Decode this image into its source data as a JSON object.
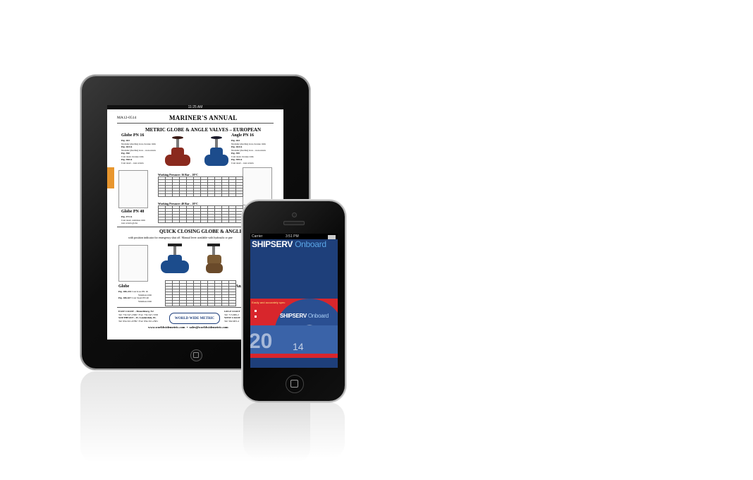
{
  "ipad": {
    "status_time": "11:25 AM",
    "doc": {
      "code": "MA12-0514",
      "title": "MARINER'S  ANNUAL",
      "section1": "METRIC GLOBE & ANGLE VALVES – EUROPEAN",
      "left_heading": "Globe PN 16",
      "right_heading": "Angle PN 16",
      "left_items": [
        "Fig. 263",
        "Nodular (ductile) iron, bronze trim",
        "Fig. 263/A",
        "Nodular (ductile) iron – non return",
        "Fig. 390",
        "Cast steel, bronze trim",
        "Fig. 390/A",
        "Cast steel – non return"
      ],
      "right_items": [
        "Fig. 264",
        "Nodular (ductile) iron, bronze trim",
        "Fig. 264/A",
        "Nodular (ductile) iron – non return",
        "Fig. 399",
        "Cast steel, bronze trim",
        "Fig. 399/A",
        "Cast steel – non return"
      ],
      "pressure1": "Working Pressure: 16 Bar – 20°C",
      "pressure2": "Working Pressure: 40 Bar – 20°C",
      "globe40_heading": "Globe PN 40",
      "globe40_items": [
        "Fig. 471/A",
        "Cast steel, stainless trim",
        "non return globe"
      ],
      "section2": "QUICK CLOSING GLOBE & ANGLE",
      "subnote": "with position indicator for emergency shut off. Manual lever available with hydraulic or pne",
      "globe_label": "Globe",
      "globe_items": [
        "Fig. 186-241",
        "Cast Iron PN 16",
        "Stainless trim",
        "Fig. 186-617",
        "Cast Steel PN 40",
        "Stainless trim"
      ],
      "angle_label": "Angle",
      "east_coast": "EAST COAST – Branchburg, NJ",
      "east_tel": "Tel: 732-547-2300 • Fax: 732-547-7258",
      "southeast": "SOUTHEAST – Ft. Lauderdale, FL",
      "southeast_tel": "Tel: 954-321-0789 • Fax: 954-321-2581",
      "logo_text": "WORLD WIDE METRIC",
      "gulf_coast": "GULF COAST",
      "gulf_tel": "Tel: 713-686-2",
      "west_coast": "WEST COAST",
      "west_tel": "Tel: 562-903-4",
      "website": "www.worldwidemetric.com",
      "email": "sales@worldwidemetric.com"
    }
  },
  "iphone": {
    "carrier": "Carrier",
    "status_time": "3:51 PM",
    "brand": "SHIPSERV",
    "product": "Onboard",
    "tagline": "Easily and accurately spec",
    "year_partial": "20",
    "year_suffix": "14",
    "disc_brand": "SHIPSERV",
    "disc_product": "Onboard"
  },
  "colors": {
    "ipad_bezel": "#0e0e0e",
    "iphone_bezel": "#050505",
    "shipserv_blue": "#1e3f7a",
    "shipserv_red": "#d8262c",
    "accent_orange": "#e8962e",
    "valve_red": "#8a2a1e",
    "valve_blue": "#1c4c8c"
  }
}
